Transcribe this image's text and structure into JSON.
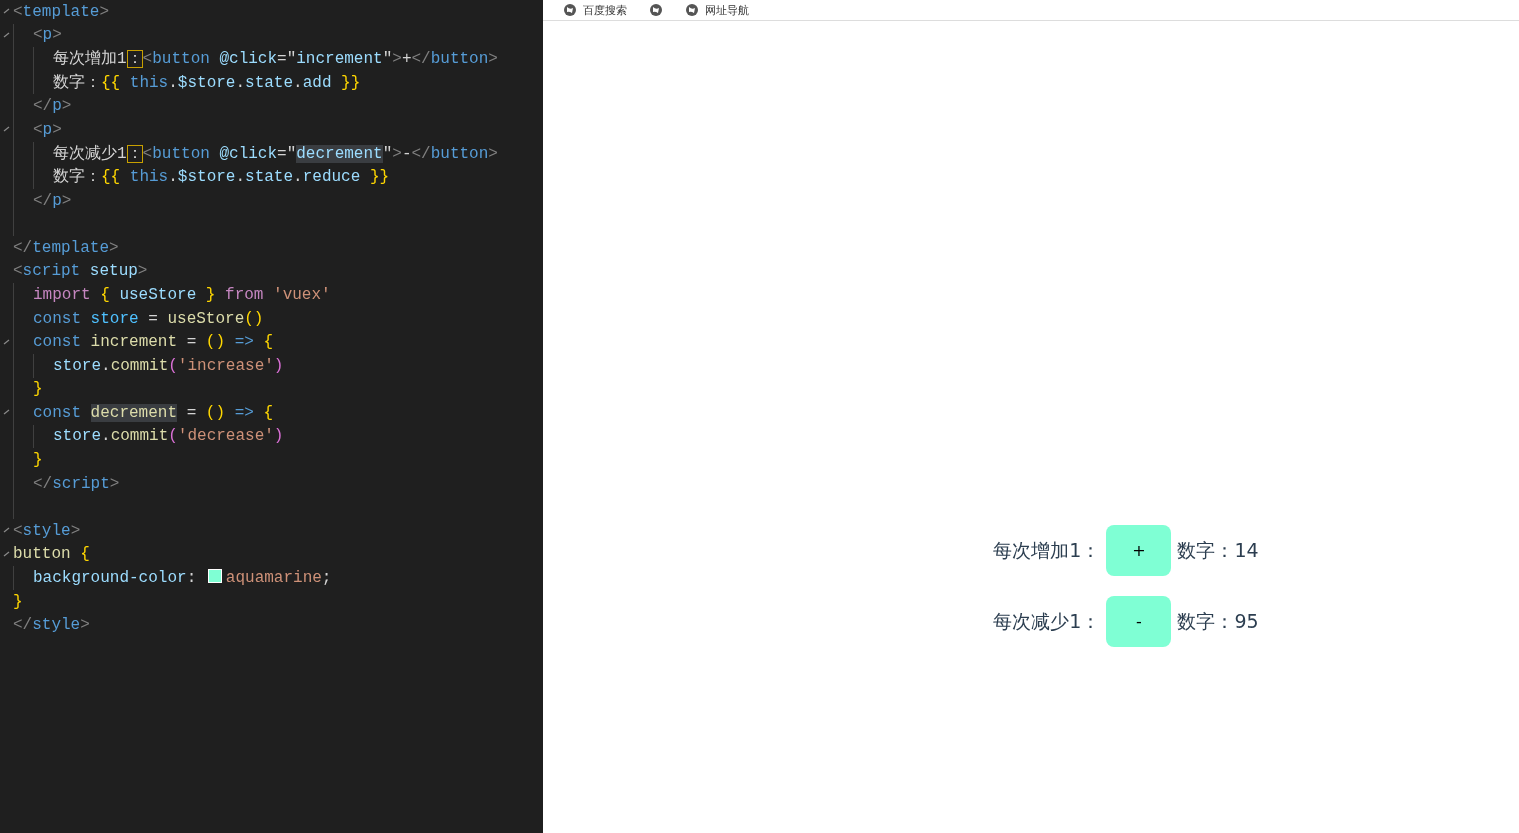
{
  "editor": {
    "lines": [
      {
        "fold": true,
        "tokens": [
          {
            "kind": "punct",
            "text": "<"
          },
          {
            "kind": "tag",
            "text": "template"
          },
          {
            "kind": "punct",
            "text": ">"
          }
        ],
        "children": [
          {
            "fold": true,
            "tokens": [
              {
                "kind": "punct",
                "text": "<"
              },
              {
                "kind": "tag",
                "text": "p"
              },
              {
                "kind": "punct",
                "text": ">"
              }
            ],
            "children": [
              {
                "fold": false,
                "tokens": [
                  {
                    "kind": "text",
                    "text": "每次增加1"
                  },
                  {
                    "kind": "boxed",
                    "text": "："
                  },
                  {
                    "kind": "punct",
                    "text": "<"
                  },
                  {
                    "kind": "tag",
                    "text": "button"
                  },
                  {
                    "kind": "attr",
                    "text": " @click"
                  },
                  {
                    "kind": "text",
                    "text": "=\""
                  },
                  {
                    "kind": "attr",
                    "text": "increment"
                  },
                  {
                    "kind": "text",
                    "text": "\""
                  },
                  {
                    "kind": "punct",
                    "text": ">"
                  },
                  {
                    "kind": "text",
                    "text": "+"
                  },
                  {
                    "kind": "punct",
                    "text": "</"
                  },
                  {
                    "kind": "tag",
                    "text": "button"
                  },
                  {
                    "kind": "punct",
                    "text": ">"
                  }
                ]
              },
              {
                "fold": false,
                "tokens": [
                  {
                    "kind": "text",
                    "text": "数字："
                  },
                  {
                    "kind": "brace",
                    "text": "{{"
                  },
                  {
                    "kind": "tag",
                    "text": " this"
                  },
                  {
                    "kind": "text",
                    "text": "."
                  },
                  {
                    "kind": "attr",
                    "text": "$store"
                  },
                  {
                    "kind": "text",
                    "text": "."
                  },
                  {
                    "kind": "attr",
                    "text": "state"
                  },
                  {
                    "kind": "text",
                    "text": "."
                  },
                  {
                    "kind": "attr",
                    "text": "add"
                  },
                  {
                    "kind": "brace",
                    "text": " }}"
                  }
                ]
              }
            ]
          },
          {
            "fold": false,
            "tokens": [
              {
                "kind": "punct",
                "text": "</"
              },
              {
                "kind": "tag",
                "text": "p"
              },
              {
                "kind": "punct",
                "text": ">"
              }
            ]
          },
          {
            "fold": true,
            "tokens": [
              {
                "kind": "punct",
                "text": "<"
              },
              {
                "kind": "tag",
                "text": "p"
              },
              {
                "kind": "punct",
                "text": ">"
              }
            ],
            "children": [
              {
                "fold": false,
                "tokens": [
                  {
                    "kind": "text",
                    "text": "每次减少1"
                  },
                  {
                    "kind": "boxed",
                    "text": "："
                  },
                  {
                    "kind": "punct",
                    "text": "<"
                  },
                  {
                    "kind": "tag",
                    "text": "button"
                  },
                  {
                    "kind": "attr",
                    "text": " @click"
                  },
                  {
                    "kind": "text",
                    "text": "=\""
                  },
                  {
                    "kind": "mark",
                    "text": "decrement"
                  },
                  {
                    "kind": "text",
                    "text": "\""
                  },
                  {
                    "kind": "punct",
                    "text": ">"
                  },
                  {
                    "kind": "text",
                    "text": "-"
                  },
                  {
                    "kind": "punct",
                    "text": "</"
                  },
                  {
                    "kind": "tag",
                    "text": "button"
                  },
                  {
                    "kind": "punct",
                    "text": ">"
                  }
                ]
              },
              {
                "fold": false,
                "tokens": [
                  {
                    "kind": "text",
                    "text": "数字："
                  },
                  {
                    "kind": "brace",
                    "text": "{{"
                  },
                  {
                    "kind": "tag",
                    "text": " this"
                  },
                  {
                    "kind": "text",
                    "text": "."
                  },
                  {
                    "kind": "attr",
                    "text": "$store"
                  },
                  {
                    "kind": "text",
                    "text": "."
                  },
                  {
                    "kind": "attr",
                    "text": "state"
                  },
                  {
                    "kind": "text",
                    "text": "."
                  },
                  {
                    "kind": "attr",
                    "text": "reduce"
                  },
                  {
                    "kind": "brace",
                    "text": " }}"
                  }
                ]
              }
            ]
          },
          {
            "fold": false,
            "tokens": [
              {
                "kind": "punct",
                "text": "</"
              },
              {
                "kind": "tag",
                "text": "p"
              },
              {
                "kind": "punct",
                "text": ">"
              }
            ]
          },
          {
            "fold": false
          }
        ]
      },
      {
        "fold": false,
        "tokens": [
          {
            "kind": "punct",
            "text": "</"
          },
          {
            "kind": "tag",
            "text": "template"
          },
          {
            "kind": "punct",
            "text": ">"
          }
        ]
      },
      {
        "fold": false,
        "tokens": [
          {
            "kind": "punct",
            "text": "<"
          },
          {
            "kind": "tag",
            "text": "script"
          },
          {
            "kind": "attr",
            "text": " setup"
          },
          {
            "kind": "punct",
            "text": ">"
          }
        ],
        "children": [
          {
            "fold": false,
            "tokens": [
              {
                "kind": "keyword",
                "text": "import"
              },
              {
                "kind": "brace",
                "text": " {"
              },
              {
                "kind": "attr",
                "text": " useStore"
              },
              {
                "kind": "brace",
                "text": " }"
              },
              {
                "kind": "keyword",
                "text": " from"
              },
              {
                "kind": "string",
                "text": " 'vuex'"
              }
            ]
          },
          {
            "fold": false,
            "tokens": [
              {
                "kind": "tag",
                "text": "const"
              },
              {
                "kind": "const",
                "text": " store"
              },
              {
                "kind": "text",
                "text": " = "
              },
              {
                "kind": "func",
                "text": "useStore"
              },
              {
                "kind": "brace",
                "text": "()"
              }
            ]
          },
          {
            "fold": true,
            "tokens": [
              {
                "kind": "tag",
                "text": "const"
              },
              {
                "kind": "func",
                "text": " increment"
              },
              {
                "kind": "text",
                "text": " = "
              },
              {
                "kind": "brace",
                "text": "()"
              },
              {
                "kind": "tag",
                "text": " =>"
              },
              {
                "kind": "brace",
                "text": " {"
              }
            ],
            "children": [
              {
                "fold": false,
                "tokens": [
                  {
                    "kind": "attr",
                    "text": "store"
                  },
                  {
                    "kind": "text",
                    "text": "."
                  },
                  {
                    "kind": "func",
                    "text": "commit"
                  },
                  {
                    "kind": "paren",
                    "text": "("
                  },
                  {
                    "kind": "string",
                    "text": "'increase'"
                  },
                  {
                    "kind": "paren",
                    "text": ")"
                  }
                ]
              }
            ]
          },
          {
            "fold": false,
            "tokens": [
              {
                "kind": "brace",
                "text": "}"
              }
            ]
          },
          {
            "fold": true,
            "tokens": [
              {
                "kind": "tag",
                "text": "const "
              },
              {
                "kind": "markfunc",
                "text": "decrement"
              },
              {
                "kind": "text",
                "text": " = "
              },
              {
                "kind": "brace",
                "text": "()"
              },
              {
                "kind": "tag",
                "text": " =>"
              },
              {
                "kind": "brace",
                "text": " {"
              }
            ],
            "children": [
              {
                "fold": false,
                "tokens": [
                  {
                    "kind": "attr",
                    "text": "store"
                  },
                  {
                    "kind": "text",
                    "text": "."
                  },
                  {
                    "kind": "func",
                    "text": "commit"
                  },
                  {
                    "kind": "paren",
                    "text": "("
                  },
                  {
                    "kind": "string",
                    "text": "'decrease'"
                  },
                  {
                    "kind": "paren",
                    "text": ")"
                  }
                ]
              }
            ]
          },
          {
            "fold": false,
            "tokens": [
              {
                "kind": "brace",
                "text": "}"
              }
            ]
          },
          {
            "fold": false,
            "tokens": [
              {
                "kind": "punct",
                "text": "</"
              },
              {
                "kind": "tag",
                "text": "script"
              },
              {
                "kind": "punct",
                "text": ">"
              }
            ]
          },
          {
            "fold": false
          }
        ]
      },
      {
        "fold": true,
        "tokens": [
          {
            "kind": "punct",
            "text": "<"
          },
          {
            "kind": "tag",
            "text": "style"
          },
          {
            "kind": "punct",
            "text": ">"
          }
        ]
      },
      {
        "fold": true,
        "tokens": [
          {
            "kind": "func",
            "text": "button"
          },
          {
            "kind": "brace",
            "text": " {"
          }
        ],
        "children": [
          {
            "fold": false,
            "tokens": [
              {
                "kind": "attr",
                "text": "background-color"
              },
              {
                "kind": "text",
                "text": ": "
              },
              {
                "kind": "swatch",
                "color": "#7fffd4"
              },
              {
                "kind": "string",
                "text": "aquamarine"
              },
              {
                "kind": "text",
                "text": ";"
              }
            ]
          }
        ]
      },
      {
        "fold": false,
        "tokens": [
          {
            "kind": "brace",
            "text": "}"
          }
        ]
      },
      {
        "fold": false,
        "tokens": [
          {
            "kind": "punct",
            "text": "</"
          },
          {
            "kind": "tag",
            "text": "style"
          },
          {
            "kind": "punct",
            "text": ">"
          }
        ]
      }
    ]
  },
  "browser": {
    "bookmarks": [
      {
        "kind": "link",
        "label": "百度搜索"
      },
      {
        "kind": "icon"
      },
      {
        "kind": "link",
        "label": "网址导航"
      }
    ],
    "rows": [
      {
        "label": "每次增加1：",
        "button": "+",
        "count": "数字：14"
      },
      {
        "label": "每次减少1：",
        "button": "-",
        "count": "数字：95"
      }
    ]
  }
}
